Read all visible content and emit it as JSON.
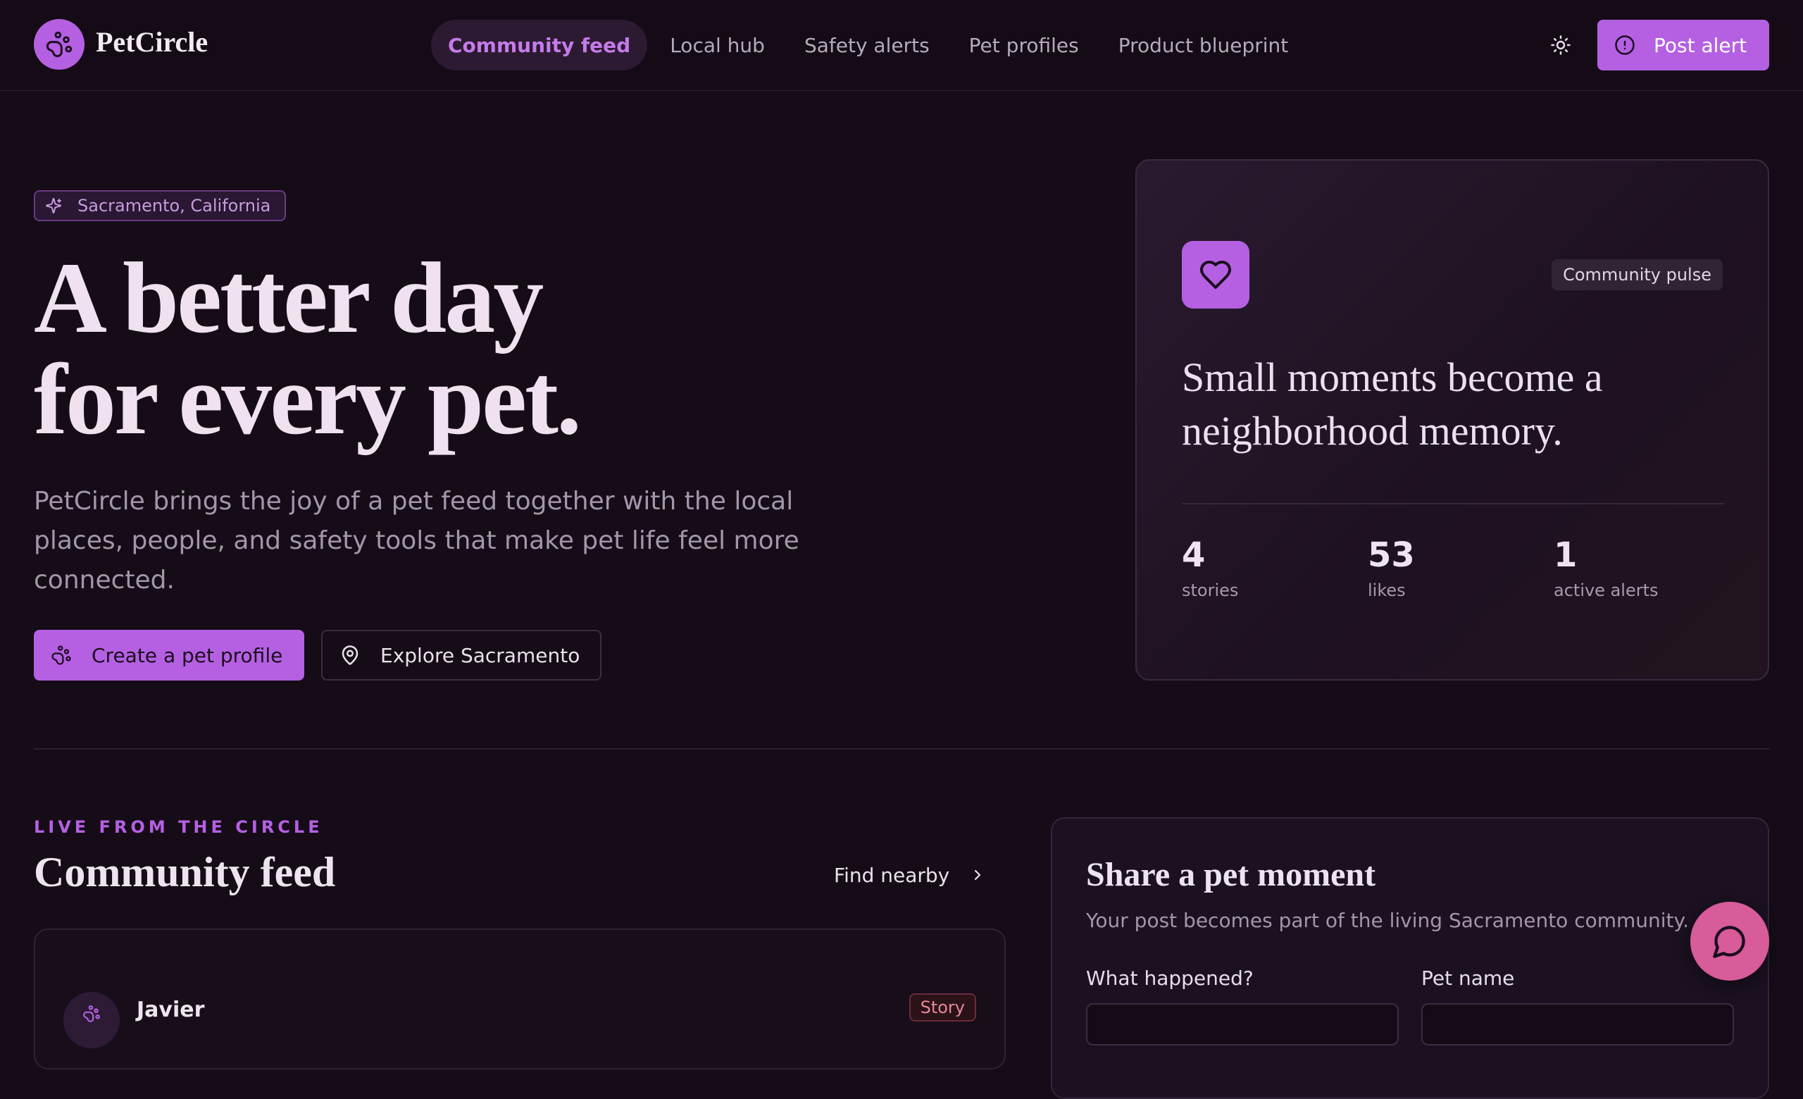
{
  "app": {
    "brand": "PetCircle"
  },
  "nav": {
    "links": [
      {
        "label": "Community feed",
        "active": true
      },
      {
        "label": "Local hub",
        "active": false
      },
      {
        "label": "Safety alerts",
        "active": false
      },
      {
        "label": "Pet profiles",
        "active": false
      },
      {
        "label": "Product blueprint",
        "active": false
      }
    ],
    "theme_icon": "sun-icon",
    "post_alert_label": "Post alert",
    "post_alert_icon": "alert-circle-icon"
  },
  "hero": {
    "location": "Sacramento, California",
    "title_line1": "A better day",
    "title_line2": "for every pet.",
    "description": "PetCircle brings the joy of a pet feed together with the local places, people, and safety tools that make pet life feel more connected.",
    "primary_cta": "Create a pet profile",
    "secondary_cta": "Explore Sacramento"
  },
  "pulse": {
    "badge": "Community pulse",
    "quote": "Small moments become a neighborhood memory.",
    "stats": [
      {
        "value": "4",
        "label": "stories"
      },
      {
        "value": "53",
        "label": "likes"
      },
      {
        "value": "1",
        "label": "active alerts"
      }
    ]
  },
  "feed": {
    "eyebrow": "LIVE FROM THE CIRCLE",
    "title": "Community feed",
    "find_nearby": "Find nearby",
    "first_post": {
      "author": "Javier",
      "tag": "Story"
    }
  },
  "share": {
    "title": "Share a pet moment",
    "subtitle": "Your post becomes part of the living Sacramento community.",
    "field1_label": "What happened?",
    "field2_label": "Pet name"
  },
  "colors": {
    "accent": "#b560e3",
    "background": "#150c17",
    "chat_fab": "#d85b9a",
    "story_tag": "#e7889a"
  }
}
